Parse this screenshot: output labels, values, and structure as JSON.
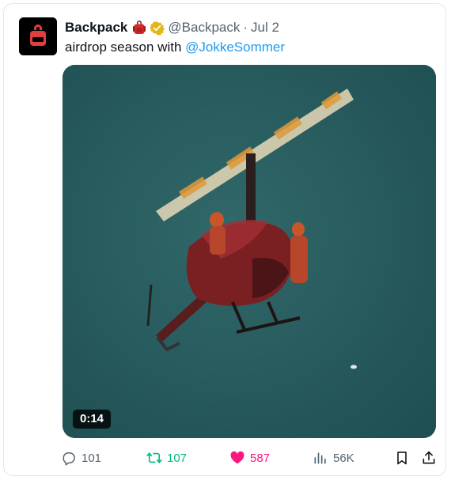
{
  "tweet": {
    "author_name": "Backpack",
    "handle": "@Backpack",
    "separator": "·",
    "date": "Jul 2",
    "text_prefix": "airdrop season with ",
    "mention": "@JokkeSommer"
  },
  "media": {
    "duration": "0:14"
  },
  "actions": {
    "replies": "101",
    "retweets": "107",
    "likes": "587",
    "views": "56K"
  },
  "colors": {
    "accent_blue": "#1d9bf0",
    "retweet_green": "#00ba7c",
    "like_pink": "#f91880",
    "muted": "#536471",
    "verified_gold": "#e2b719"
  },
  "icons": {
    "avatar": "backpack-logo",
    "emoji": "backpack-emoji",
    "verified": "gold-verified-badge",
    "reply": "reply-icon",
    "retweet": "retweet-icon",
    "like": "heart-icon",
    "views": "views-icon",
    "bookmark": "bookmark-icon",
    "share": "share-icon"
  }
}
